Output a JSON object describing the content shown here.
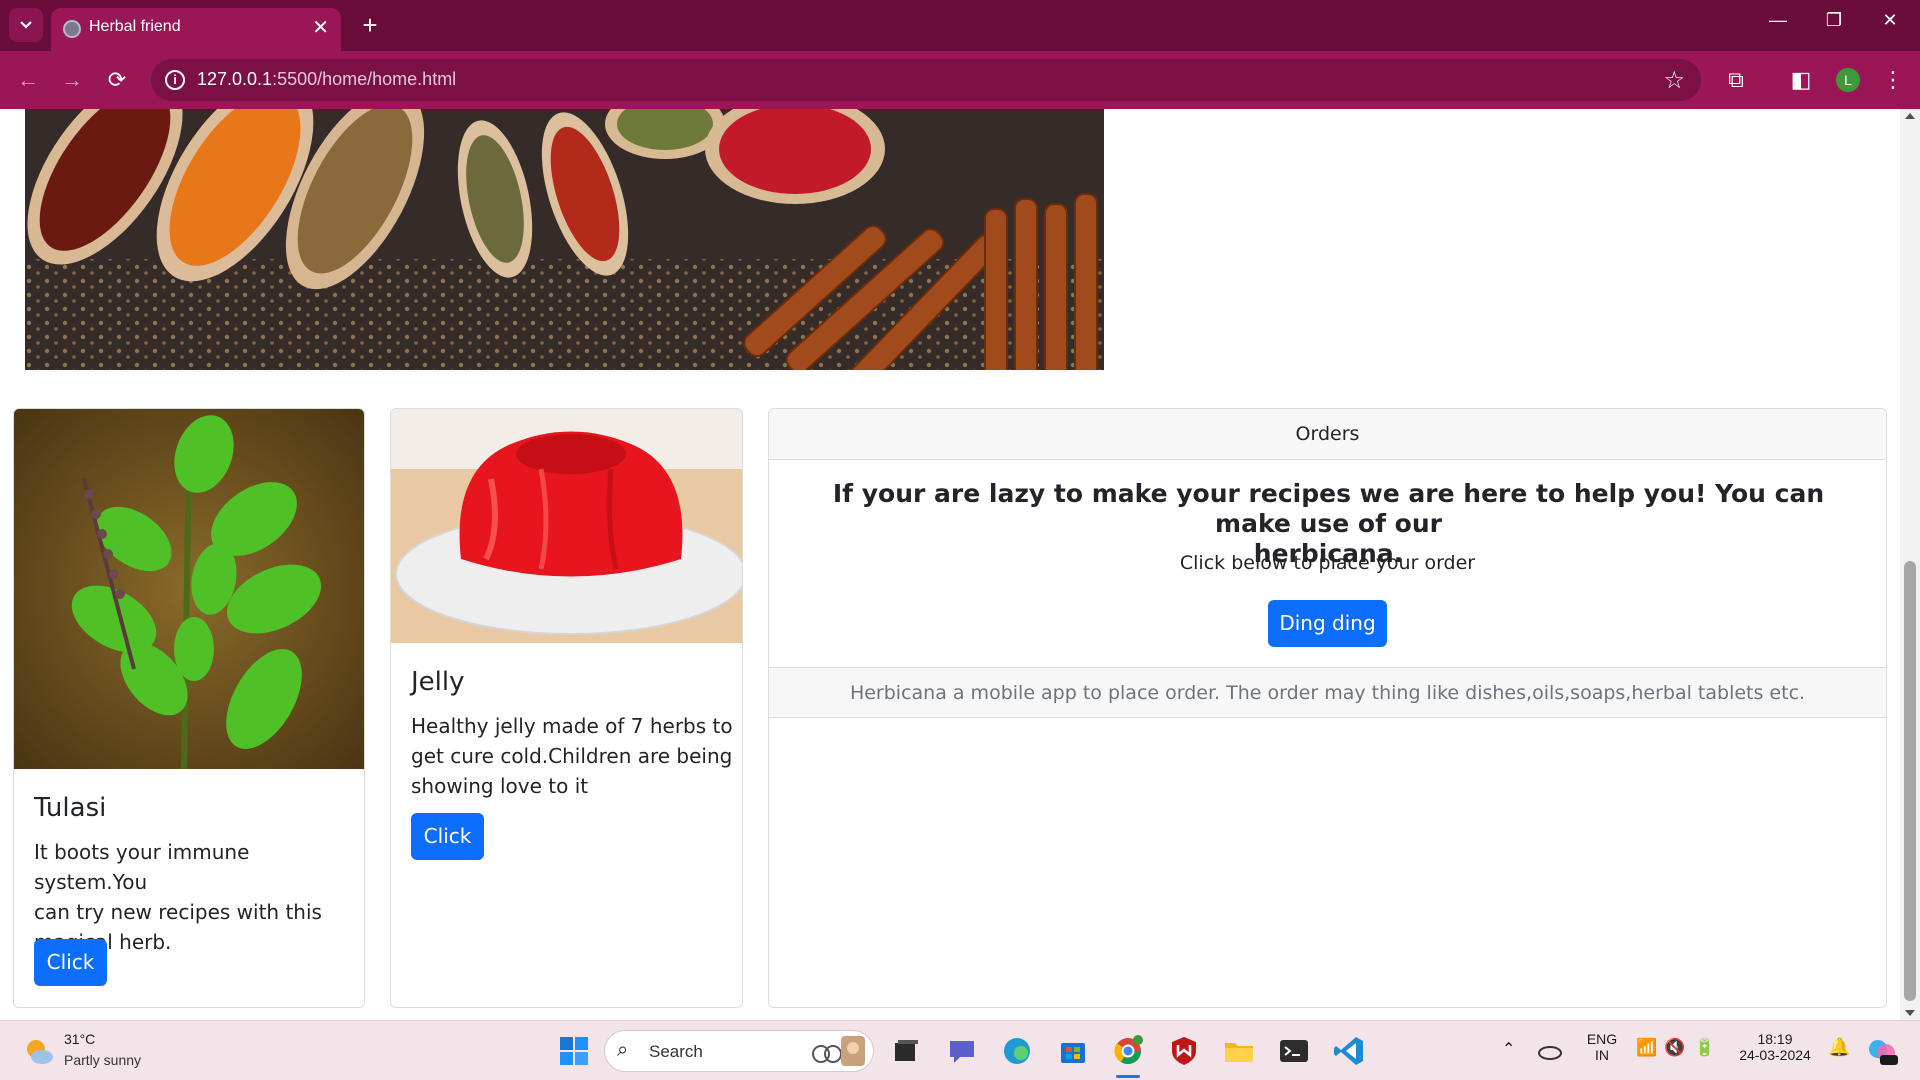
{
  "browser": {
    "tab_title": "Herbal friend",
    "url_host": "127.0.0.1",
    "url_path": ":5500/home/home.html",
    "profile_initial": "L"
  },
  "cards": [
    {
      "title": "Tulasi",
      "text_lines": [
        "It boots your immune system.You",
        "can try new recipes with this",
        "magical herb."
      ],
      "button": "Click"
    },
    {
      "title": "Jelly",
      "text_lines": [
        "Healthy jelly made of 7 herbs to",
        "get cure cold.Children are being",
        "showing love to it"
      ],
      "button": "Click"
    }
  ],
  "orders": {
    "header": "Orders",
    "title_lines": [
      "If your are lazy to make your recipes we are here to help you! You can make use of our",
      "herbicana."
    ],
    "text": "Click below to place your order",
    "button": "Ding ding",
    "footer": "Herbicana a mobile app to place order. The order may thing like dishes,oils,soaps,herbal tablets etc."
  },
  "taskbar": {
    "weather_temp": "31°C",
    "weather_desc": "Partly sunny",
    "search_label": "Search",
    "lang_top": "ENG",
    "lang_bottom": "IN",
    "time": "18:19",
    "date": "24-03-2024"
  },
  "colors": {
    "browser_frame": "#6a0d3a",
    "browser_toolbar": "#9b1657",
    "primary_button": "#0d6efd"
  }
}
